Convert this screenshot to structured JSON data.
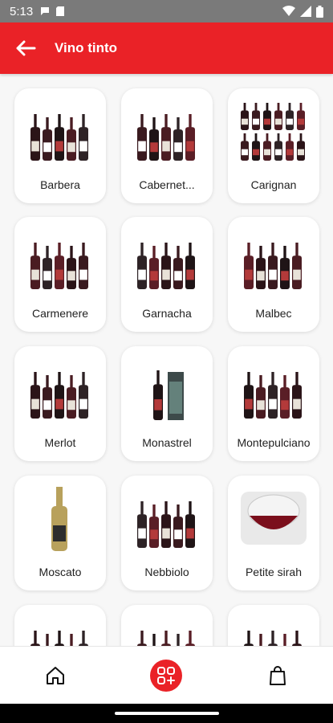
{
  "status_bar": {
    "time": "5:13"
  },
  "app_bar": {
    "title": "Vino tinto"
  },
  "categories": [
    {
      "label": "Barbera",
      "image": "bottle-group"
    },
    {
      "label": "Cabernet...",
      "image": "bottle-group"
    },
    {
      "label": "Carignan",
      "image": "bottle-stack"
    },
    {
      "label": "Carmenere",
      "image": "bottle-group"
    },
    {
      "label": "Garnacha",
      "image": "bottle-group"
    },
    {
      "label": "Malbec",
      "image": "bottle-group"
    },
    {
      "label": "Merlot",
      "image": "bottle-group"
    },
    {
      "label": "Monastrel",
      "image": "bottle-with-box"
    },
    {
      "label": "Montepulciano",
      "image": "bottle-group"
    },
    {
      "label": "Moscato",
      "image": "single-white-bottle"
    },
    {
      "label": "Nebbiolo",
      "image": "bottle-group"
    },
    {
      "label": "Petite sirah",
      "image": "wine-glass"
    },
    {
      "label": "",
      "image": "bottle-group"
    },
    {
      "label": "",
      "image": "bottle-group"
    },
    {
      "label": "",
      "image": "bottle-group"
    }
  ],
  "bottom_nav": {
    "items": [
      {
        "name": "home",
        "icon": "home-icon"
      },
      {
        "name": "categories",
        "icon": "categories-icon",
        "active": true
      },
      {
        "name": "cart",
        "icon": "shopping-bag-icon"
      }
    ]
  },
  "colors": {
    "primary": "#ea2227",
    "status_bar": "#7a7a7a",
    "background": "#f7f7f7"
  }
}
